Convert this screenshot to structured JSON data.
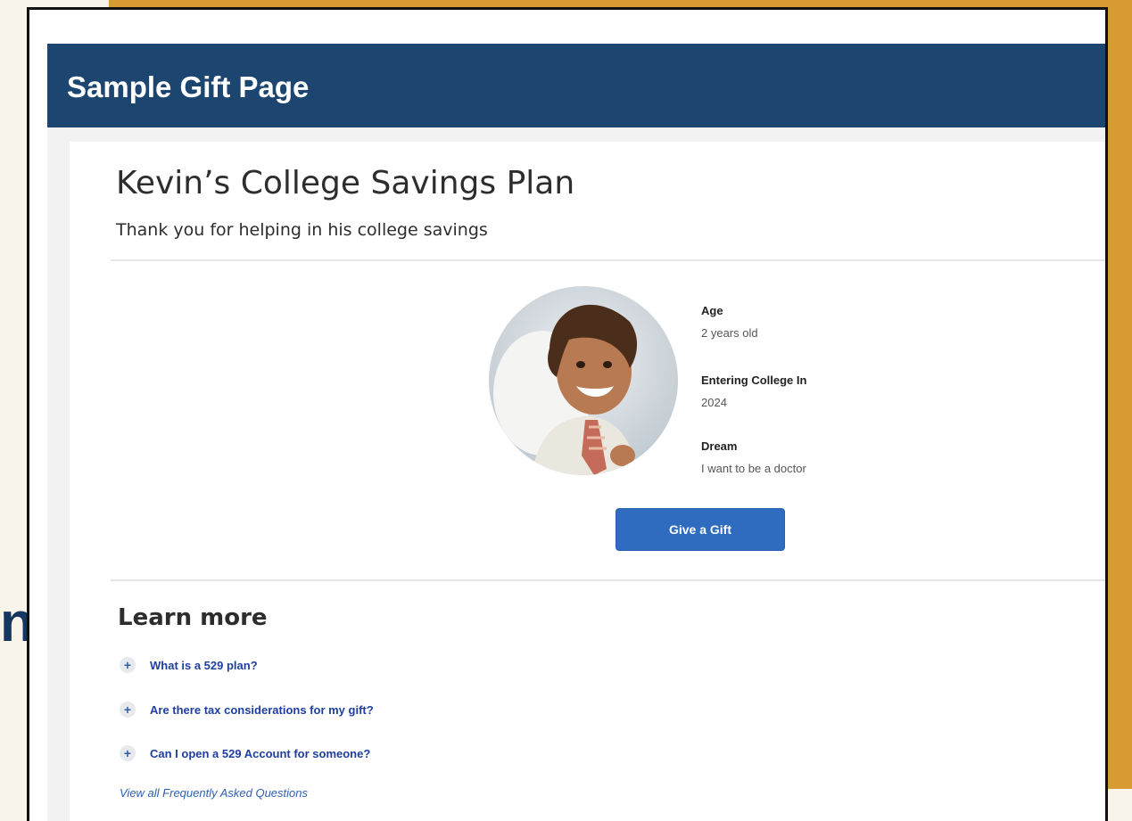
{
  "page": {
    "header_title": "Sample Gift Page",
    "partial_background_letter": "n"
  },
  "plan": {
    "title": "Kevin’s College Savings Plan",
    "subtitle": "Thank you for helping in his college savings"
  },
  "profile": {
    "avatar": "child-photo",
    "fields": [
      {
        "label": "Age",
        "value": "2 years old"
      },
      {
        "label": "Entering College In",
        "value": "2024"
      },
      {
        "label": "Dream",
        "value": "I want to be a doctor"
      }
    ]
  },
  "actions": {
    "give_gift_label": "Give a Gift"
  },
  "learn_more": {
    "title": "Learn more",
    "faqs": [
      {
        "label": "What is a 529 plan?",
        "icon": "plus-circle-icon"
      },
      {
        "label": "Are there tax considerations for my gift?",
        "icon": "plus-circle-icon"
      },
      {
        "label": "Can I open a 529 Account for someone?",
        "icon": "plus-circle-icon"
      }
    ],
    "view_all_label": "View all Frequently Asked Questions"
  },
  "colors": {
    "header_bg": "#1c456f",
    "button_bg": "#2f6cc0",
    "link": "#1f3fa0",
    "accent_gold": "#d89a33"
  }
}
